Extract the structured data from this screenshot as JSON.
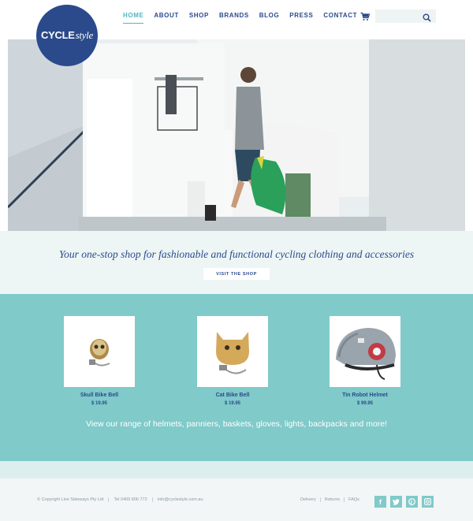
{
  "brand": {
    "logo_main": "CYCLE",
    "logo_script": "style"
  },
  "nav": {
    "items": [
      {
        "label": "HOME",
        "active": true
      },
      {
        "label": "ABOUT"
      },
      {
        "label": "SHOP"
      },
      {
        "label": "BRANDS"
      },
      {
        "label": "BLOG"
      },
      {
        "label": "PRESS"
      },
      {
        "label": "CONTACT"
      }
    ]
  },
  "search": {
    "placeholder": ""
  },
  "icons": {
    "cart": "cart-icon",
    "search": "search-icon"
  },
  "tagline": {
    "text": "Your one-stop shop for fashionable and functional cycling clothing and accessories",
    "button": "VISIT THE SHOP"
  },
  "products": [
    {
      "name": "Skull Bike Bell",
      "price": "$ 19.95"
    },
    {
      "name": "Cat Bike Bell",
      "price": "$ 19.95"
    },
    {
      "name": "Tin Robot Helmet",
      "price": "$ 99.95"
    }
  ],
  "range_text": "View our range of helmets, panniers, baskets, gloves, lights, backpacks and more!",
  "footer": {
    "copyright": "© Copyright Live Sideways Pty Ltd",
    "phone": "Tel 0409 806 772",
    "email": "info@cyclestyle.com.au",
    "links": [
      "Delivery",
      "Returns",
      "FAQs"
    ],
    "social": [
      "facebook-icon",
      "twitter-icon",
      "pinterest-icon",
      "instagram-icon"
    ]
  },
  "colors": {
    "brand_blue": "#2a4a8c",
    "teal": "#80cac9",
    "accent": "#4fb6c2"
  }
}
